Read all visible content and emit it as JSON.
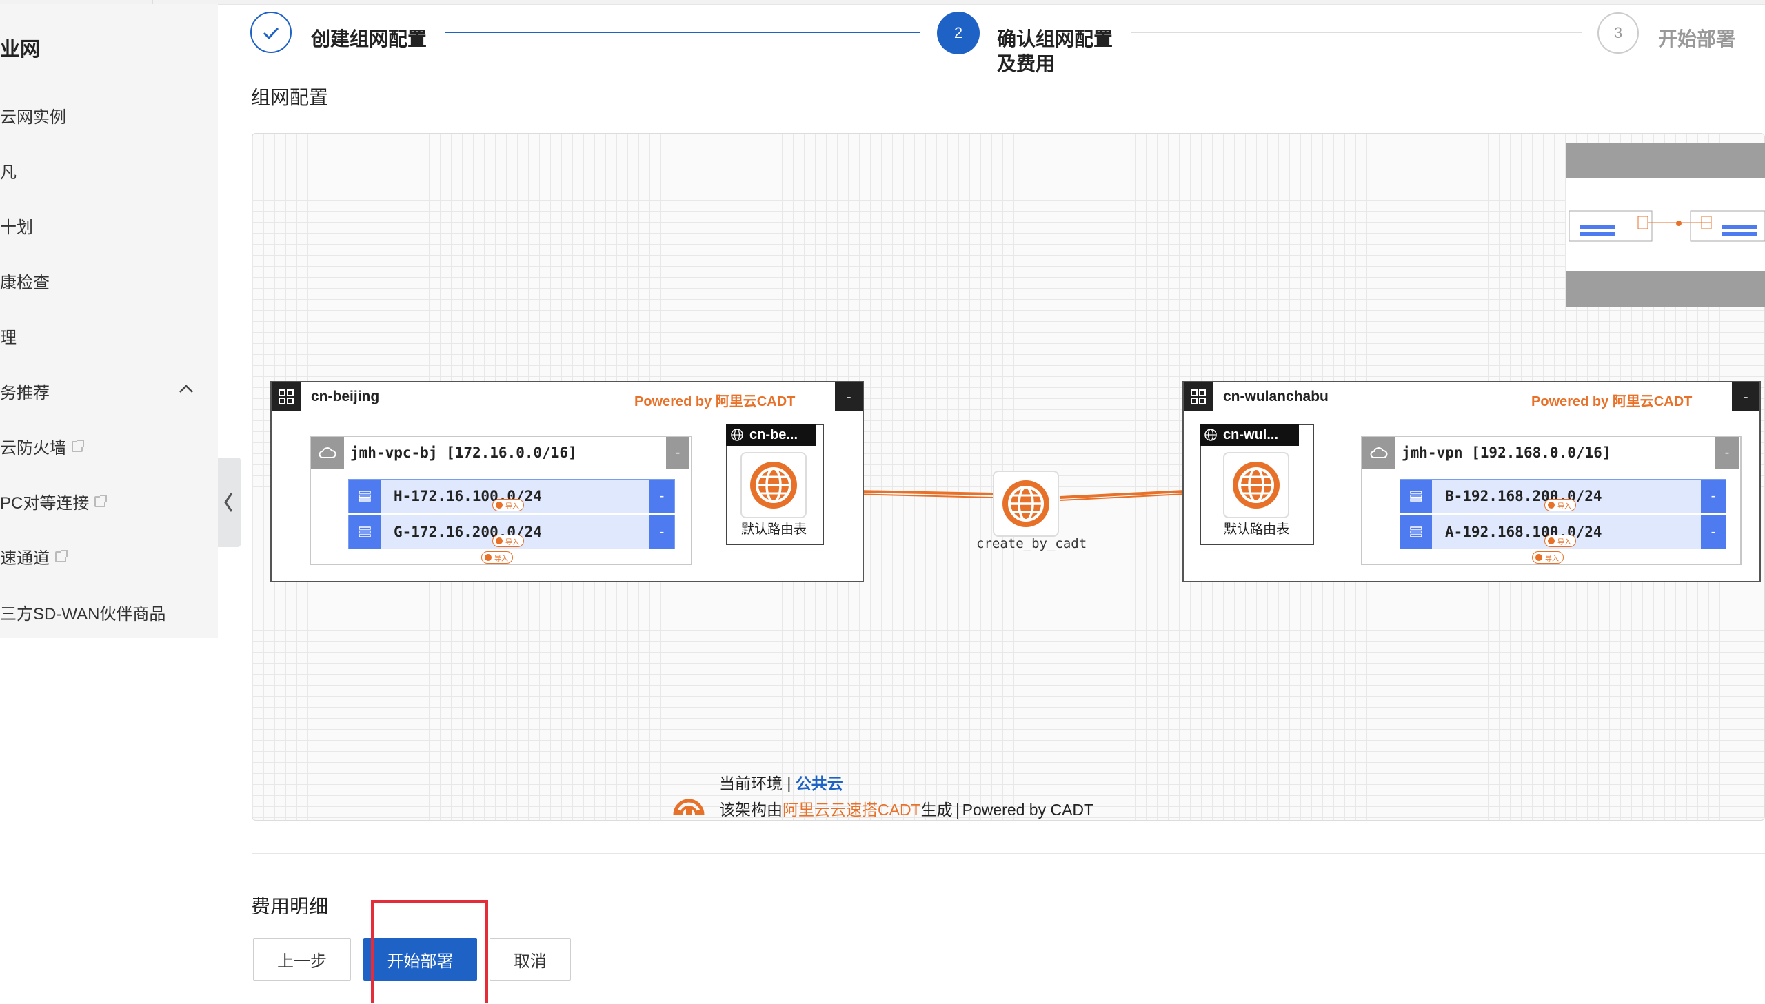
{
  "sidebar": {
    "title": "业网",
    "items": [
      {
        "label": "云网实例",
        "external": false
      },
      {
        "label": "凡",
        "external": false
      },
      {
        "label": "十划",
        "external": false
      },
      {
        "label": "康检查",
        "external": false
      },
      {
        "label": "理",
        "external": false
      },
      {
        "label": "务推荐",
        "external": false,
        "expandable": true
      },
      {
        "label": "云防火墙",
        "external": true
      },
      {
        "label": "PC对等连接",
        "external": true
      },
      {
        "label": "速通道",
        "external": true
      },
      {
        "label": "三方SD-WAN伙伴商品",
        "external": false
      }
    ]
  },
  "stepper": {
    "steps": [
      {
        "number": "1",
        "label": "创建组网配置",
        "status": "done"
      },
      {
        "number": "2",
        "label_line1": "确认组网配置",
        "label_line2": "及费用",
        "status": "active"
      },
      {
        "number": "3",
        "label": "开始部署",
        "status": "todo"
      }
    ]
  },
  "section_network": "组网配置",
  "topology": {
    "regions": [
      {
        "name": "cn-beijing",
        "powered": "Powered by 阿里云CADT",
        "minus": "-",
        "vpc": {
          "name": "jmh-vpc-bj [172.16.0.0/16]",
          "minus": "-",
          "vswitches": [
            {
              "name": "H-172.16.100.0/24",
              "tag": "导入",
              "minus": "-"
            },
            {
              "name": "G-172.16.200.0/24",
              "tag": "导入",
              "minus": "-"
            }
          ]
        },
        "route_table": {
          "title": "cn-be...",
          "label": "默认路由表"
        }
      },
      {
        "name": "cn-wulanchabu",
        "powered": "Powered by 阿里云CADT",
        "minus": "-",
        "vpc": {
          "name": "jmh-vpn [192.168.0.0/16]",
          "minus": "-",
          "vswitches": [
            {
              "name": "B-192.168.200.0/24",
              "tag": "导入",
              "minus": "-"
            },
            {
              "name": "A-192.168.100.0/24",
              "tag": "导入",
              "minus": "-"
            }
          ]
        },
        "route_table": {
          "title": "cn-wul...",
          "label": "默认路由表"
        }
      }
    ],
    "cen": {
      "label": "create_by_cadt"
    },
    "footer": {
      "env_prefix": "当前环境 | ",
      "env_value": "公共云",
      "gen_prefix": "该架构由",
      "gen_link": "阿里云云速搭CADT",
      "gen_suffix": "生成",
      "gen_powered": "Powered by CADT"
    }
  },
  "section_cost": "费用明细",
  "buttons": {
    "prev": "上一步",
    "deploy": "开始部署",
    "cancel": "取消"
  },
  "colors": {
    "primary": "#1f62c6",
    "orange": "#e8712a",
    "vswitch_blue": "#4f7bf0",
    "highlight_red": "#e52d3a"
  }
}
